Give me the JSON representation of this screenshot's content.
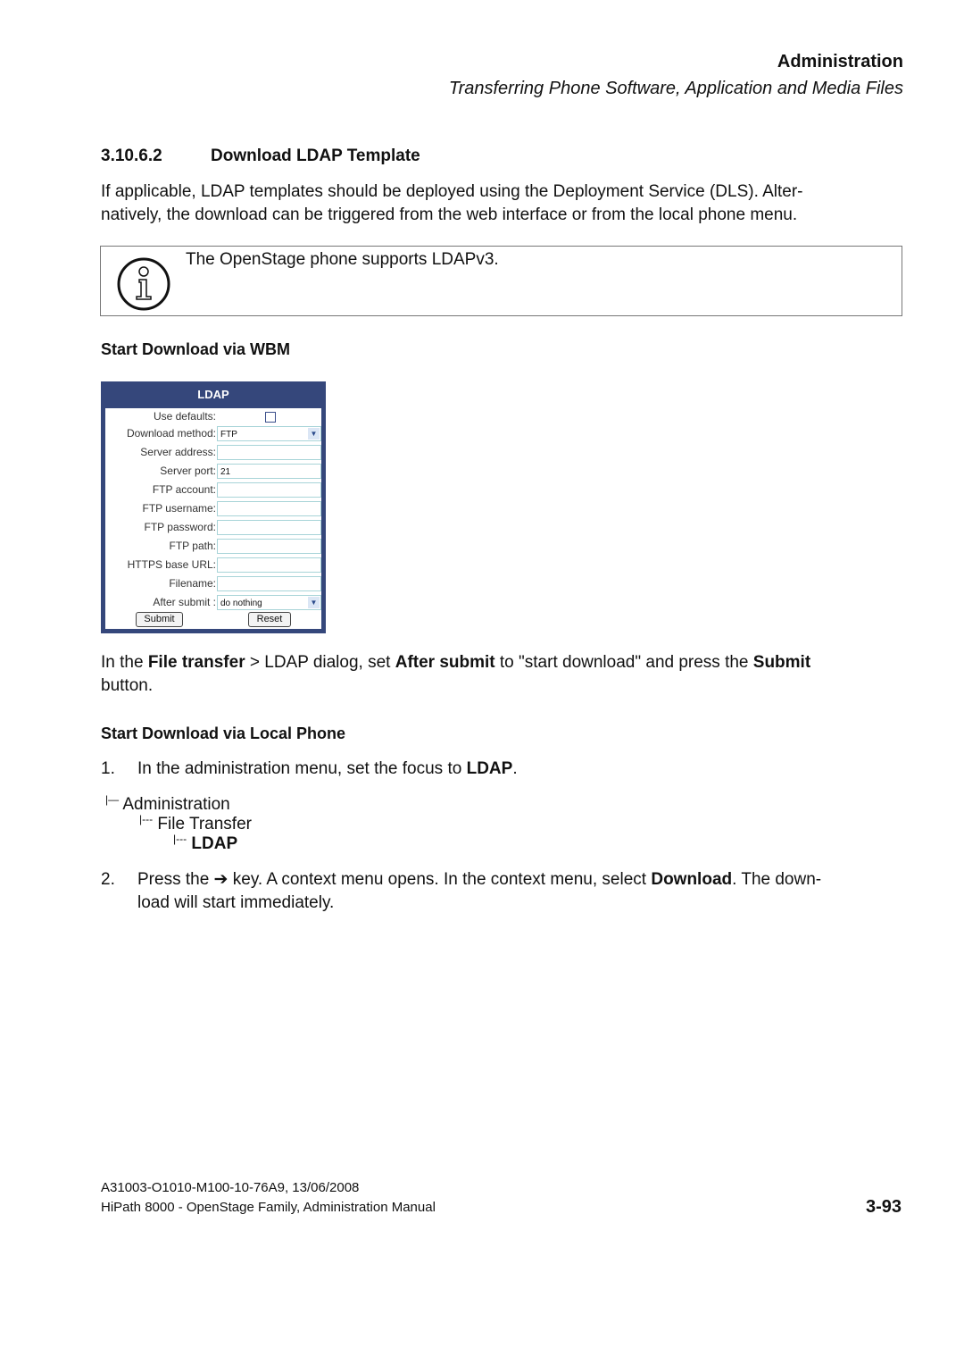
{
  "header": {
    "title": "Administration",
    "subtitle": "Transferring Phone Software, Application and Media Files"
  },
  "section": {
    "number": "3.10.6.2",
    "title": "Download LDAP Template"
  },
  "intro": {
    "line1": "If applicable, LDAP templates should be deployed using the Deployment Service (DLS). Alter-",
    "line2": "natively, the download can be triggered from the web interface or from the local phone menu."
  },
  "note": {
    "icon": "info-icon",
    "text": "The OpenStage phone supports LDAPv3."
  },
  "wbm": {
    "heading": "Start Download via WBM",
    "dialog": {
      "title": "LDAP",
      "use_defaults_label": "Use defaults:",
      "use_defaults_checked": false,
      "fields": [
        {
          "label": "Download method:",
          "value": "FTP",
          "type": "select"
        },
        {
          "label": "Server address:",
          "value": "",
          "type": "text"
        },
        {
          "label": "Server port:",
          "value": "21",
          "type": "text"
        },
        {
          "label": "FTP account:",
          "value": "",
          "type": "text"
        },
        {
          "label": "FTP username:",
          "value": "",
          "type": "text"
        },
        {
          "label": "FTP password:",
          "value": "",
          "type": "text"
        },
        {
          "label": "FTP path:",
          "value": "",
          "type": "text"
        },
        {
          "label": "HTTPS base URL:",
          "value": "",
          "type": "text"
        },
        {
          "label": "Filename:",
          "value": "",
          "type": "text"
        },
        {
          "label": "After submit :",
          "value": "do nothing",
          "type": "select"
        }
      ],
      "submit_label": "Submit",
      "reset_label": "Reset"
    },
    "instruction": {
      "p1": "In the ",
      "b1": "File transfer",
      "p2": " > LDAP dialog, set ",
      "b2": "After submit",
      "p3": " to \"start download\" and press the ",
      "b3": "Submit",
      "p4": "button."
    }
  },
  "local": {
    "heading": "Start Download via Local Phone",
    "step1": {
      "num": "1.",
      "text": "In the administration menu, set the focus to ",
      "bold": "LDAP",
      "end": "."
    },
    "tree": [
      "Administration",
      "File Transfer",
      "LDAP"
    ],
    "step2": {
      "num": "2.",
      "t1": "Press the ",
      "arrow": "➔",
      "t2": " key. A context menu opens. In the context menu, select ",
      "bold": "Download",
      "t3": ". The down-",
      "line2": "load will start immediately."
    }
  },
  "footer": {
    "doc_id": "A31003-O1010-M100-10-76A9, 13/06/2008",
    "manual": "HiPath 8000 - OpenStage Family, Administration Manual",
    "page": "3-93"
  }
}
